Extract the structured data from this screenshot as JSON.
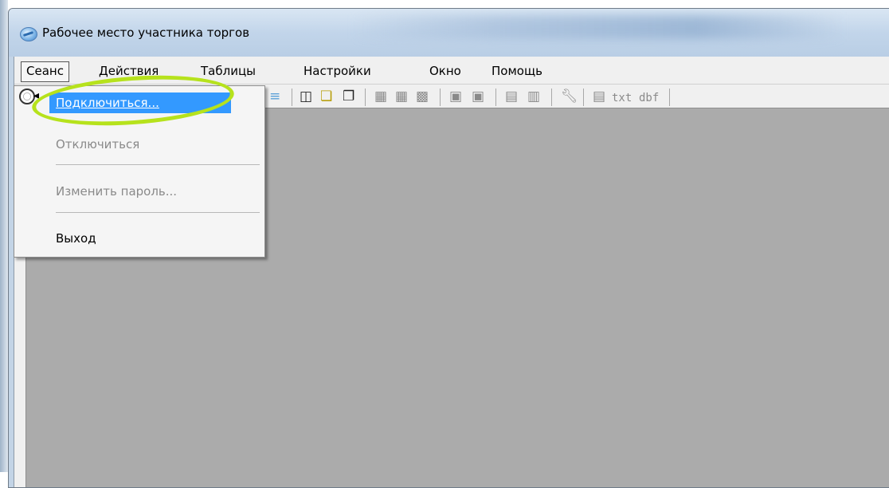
{
  "window": {
    "title": "Рабочее место участника торгов"
  },
  "menubar": {
    "items": [
      "Сеанс",
      "Действия",
      "Таблицы",
      "Настройки",
      "Окно",
      "Помощь"
    ]
  },
  "toolbar": {
    "txt_label": "txt",
    "dbf_label": "dbf"
  },
  "session_menu": {
    "items": [
      {
        "label": "Подключиться...",
        "state": "highlighted"
      },
      {
        "label": "Отключиться",
        "state": "disabled"
      },
      {
        "label": "Изменить пароль...",
        "state": "disabled"
      },
      {
        "label": "Выход",
        "state": "enabled"
      }
    ]
  },
  "colors": {
    "highlight": "#3399ff",
    "workspace": "#ababab",
    "annotation_ring": "#b6e21c"
  }
}
